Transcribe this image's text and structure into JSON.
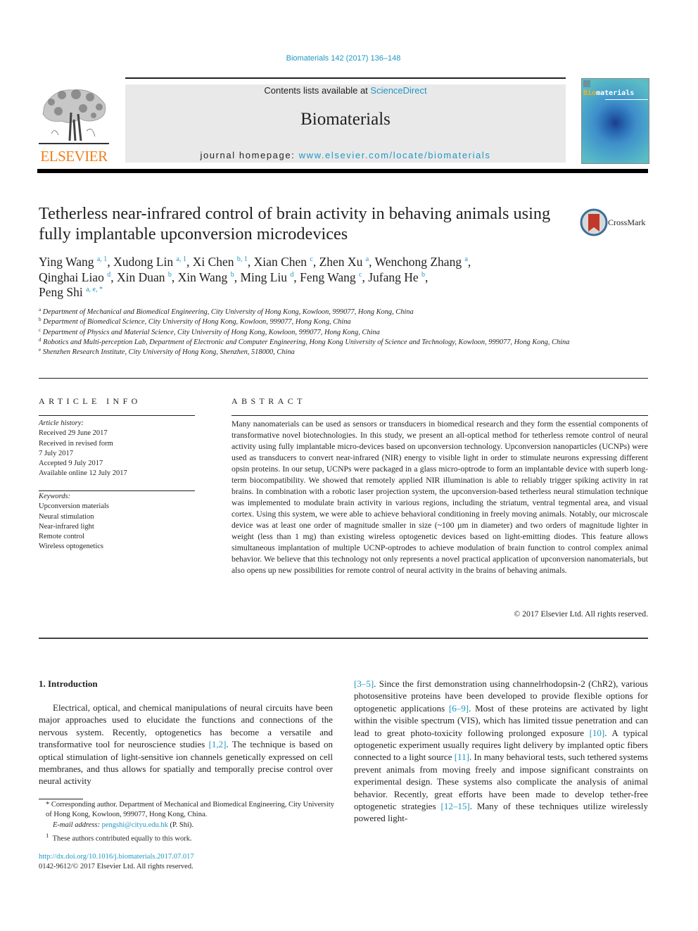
{
  "header": {
    "citation": "Biomaterials 142 (2017) 136–148",
    "contents_prefix": "Contents lists available at ",
    "contents_link": "ScienceDirect",
    "journal_name": "Biomaterials",
    "homepage_prefix": "journal homepage: ",
    "homepage_link": "www.elsevier.com/locate/biomaterials",
    "publisher_logo_text": "ELSEVIER",
    "cover_title_accent": "Bio",
    "cover_title_rest": "materials",
    "accent_color": "#2196c4",
    "publisher_color": "#f07f1a"
  },
  "article": {
    "title": "Tetherless near-infrared control of brain activity in behaving animals using fully implantable upconversion microdevices",
    "crossmark_label": "CrossMark",
    "authors": [
      {
        "name": "Ying Wang",
        "sup": "a, 1",
        "sep": ", "
      },
      {
        "name": "Xudong Lin",
        "sup": "a, 1",
        "sep": ", "
      },
      {
        "name": "Xi Chen",
        "sup": "b, 1",
        "sep": ", "
      },
      {
        "name": "Xian Chen",
        "sup": "c",
        "sep": ", "
      },
      {
        "name": "Zhen Xu",
        "sup": "a",
        "sep": ", "
      },
      {
        "name": "Wenchong Zhang",
        "sup": "a",
        "sep": ","
      },
      {
        "name": "Qinghai Liao",
        "sup": "d",
        "sep": ", "
      },
      {
        "name": "Xin Duan",
        "sup": "b",
        "sep": ", "
      },
      {
        "name": "Xin Wang",
        "sup": "b",
        "sep": ", "
      },
      {
        "name": "Ming Liu",
        "sup": "d",
        "sep": ", "
      },
      {
        "name": "Feng Wang",
        "sup": "c",
        "sep": ", "
      },
      {
        "name": "Jufang He",
        "sup": "b",
        "sep": ","
      },
      {
        "name": "Peng Shi",
        "sup": "a, e, *",
        "sep": ""
      }
    ],
    "affiliations": [
      {
        "key": "a",
        "text": "Department of Mechanical and Biomedical Engineering, City University of Hong Kong, Kowloon, 999077, Hong Kong, China"
      },
      {
        "key": "b",
        "text": "Department of Biomedical Science, City University of Hong Kong, Kowloon, 999077, Hong Kong, China"
      },
      {
        "key": "c",
        "text": "Department of Physics and Material Science, City University of Hong Kong, Kowloon, 999077, Hong Kong, China"
      },
      {
        "key": "d",
        "text": "Robotics and Multi-perception Lab, Department of Electronic and Computer Engineering, Hong Kong University of Science and Technology, Kowloon, 999077, Hong Kong, China"
      },
      {
        "key": "e",
        "text": "Shenzhen Research Institute, City University of Hong Kong, Shenzhen, 518000, China"
      }
    ]
  },
  "article_info": {
    "heading": "ARTICLE INFO",
    "history_label": "Article history:",
    "history": [
      "Received 29 June 2017",
      "Received in revised form",
      "7 July 2017",
      "Accepted 9 July 2017",
      "Available online 12 July 2017"
    ],
    "keywords_label": "Keywords:",
    "keywords": [
      "Upconversion materials",
      "Neural stimulation",
      "Near-infrared light",
      "Remote control",
      "Wireless optogenetics"
    ]
  },
  "abstract": {
    "heading": "ABSTRACT",
    "text": "Many nanomaterials can be used as sensors or transducers in biomedical research and they form the essential components of transformative novel biotechnologies. In this study, we present an all-optical method for tetherless remote control of neural activity using fully implantable micro-devices based on upconversion technology. Upconversion nanoparticles (UCNPs) were used as transducers to convert near-infrared (NIR) energy to visible light in order to stimulate neurons expressing different opsin proteins. In our setup, UCNPs were packaged in a glass micro-optrode to form an implantable device with superb long-term biocompatibility. We showed that remotely applied NIR illumination is able to reliably trigger spiking activity in rat brains. In combination with a robotic laser projection system, the upconversion-based tetherless neural stimulation technique was implemented to modulate brain activity in various regions, including the striatum, ventral tegmental area, and visual cortex. Using this system, we were able to achieve behavioral conditioning in freely moving animals. Notably, our microscale device was at least one order of magnitude smaller in size (~100 µm in diameter) and two orders of magnitude lighter in weight (less than 1 mg) than existing wireless optogenetic devices based on light-emitting diodes. This feature allows simultaneous implantation of multiple UCNP-optrodes to achieve modulation of brain function to control complex animal behavior. We believe that this technology not only represents a novel practical application of upconversion nanomaterials, but also opens up new possibilities for remote control of neural activity in the brains of behaving animals.",
    "copyright": "© 2017 Elsevier Ltd. All rights reserved."
  },
  "body": {
    "section_heading": "1.  Introduction",
    "left_column": [
      {
        "t": "Electrical, optical, and chemical manipulations of neural circuits have been major approaches used to elucidate the functions and connections of the nervous system. Recently, optogenetics has become a versatile and transformative tool for neuroscience studies "
      },
      {
        "ref": "[1,2]"
      },
      {
        "t": ". The technique is based on optical stimulation of light-sensitive ion channels genetically expressed on cell membranes, and thus allows for spatially and temporally precise control over neural activity"
      }
    ],
    "right_column": [
      {
        "ref": "[3–5]"
      },
      {
        "t": ". Since the first demonstration using channelrhodopsin-2 (ChR2), various photosensitive proteins have been developed to provide flexible options for optogenetic applications "
      },
      {
        "ref": "[6–9]"
      },
      {
        "t": ". Most of these proteins are activated by light within the visible spectrum (VIS), which has limited tissue penetration and can lead to great photo-toxicity following prolonged exposure "
      },
      {
        "ref": "[10]"
      },
      {
        "t": ". A typical optogenetic experiment usually requires light delivery by implanted optic fibers connected to a light source "
      },
      {
        "ref": "[11]"
      },
      {
        "t": ". In many behavioral tests, such tethered systems prevent animals from moving freely and impose significant constraints on experimental design. These systems also complicate the analysis of animal behavior. Recently, great efforts have been made to develop tether-free optogenetic strategies "
      },
      {
        "ref": "[12–15]"
      },
      {
        "t": ". Many of these techniques utilize wirelessly powered light-"
      }
    ]
  },
  "footnotes": {
    "corresponding": "* Corresponding author. Department of Mechanical and Biomedical Engineering, City University of Hong Kong, Kowloon, 999077, Hong Kong, China.",
    "email_label": "E-mail address: ",
    "email": "pengshi@cityu.edu.hk",
    "email_suffix": " (P. Shi).",
    "equal_contrib_mark": "1",
    "equal_contrib": "These authors contributed equally to this work.",
    "doi": "http://dx.doi.org/10.1016/j.biomaterials.2017.07.017",
    "issn_line": "0142-9612/© 2017 Elsevier Ltd. All rights reserved."
  }
}
